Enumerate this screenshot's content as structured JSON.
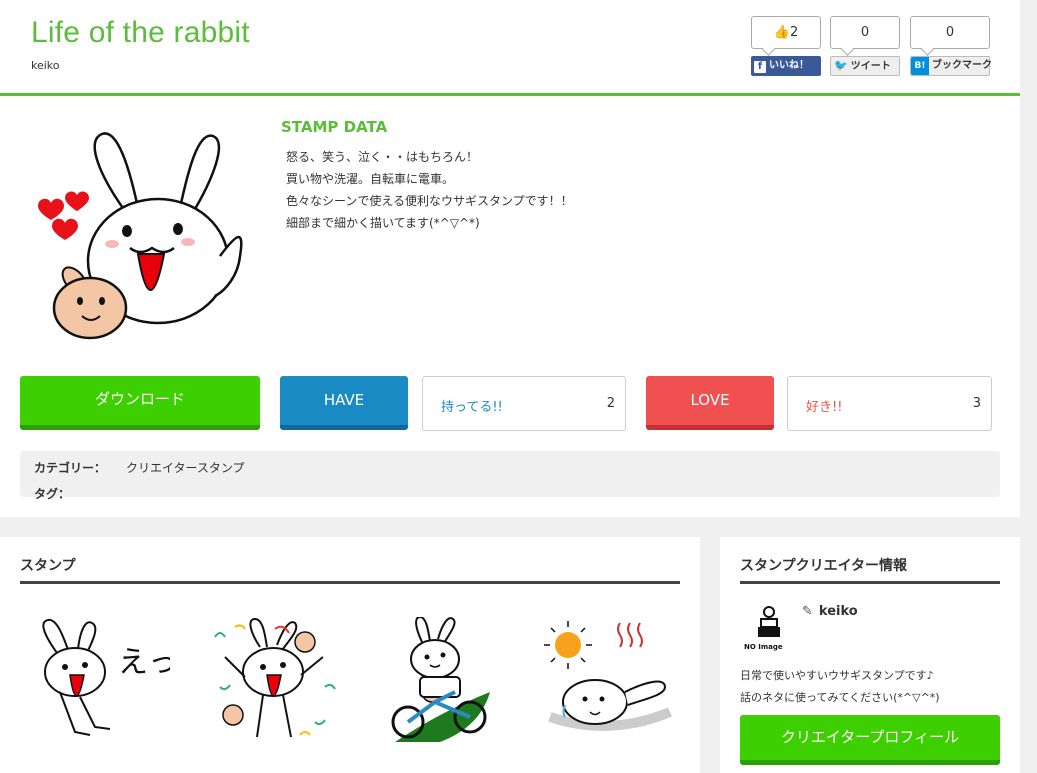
{
  "header": {
    "site_title": "Life of the rabbit",
    "author": "keiko",
    "share": {
      "facebook": {
        "count": "2",
        "label": "いいね！",
        "icon": "facebook-icon"
      },
      "twitter": {
        "count": "0",
        "label": "ツイート",
        "icon": "twitter-bird-icon"
      },
      "hatena": {
        "count": "0",
        "label": "ブックマーク",
        "icon": "hatena-bookmark-icon"
      }
    }
  },
  "stamp": {
    "section_title": "STAMP DATA",
    "description": [
      "怒る、笑う、泣く・・はもちろん！",
      "買い物や洗濯。自転車に電車。",
      "色々なシーンで使える便利なウサギスタンプです！！",
      "細部まで細かく描いてます(*^▽^*)"
    ],
    "download_label": "ダウンロード",
    "have_label": "HAVE",
    "have_text": "持ってる!!",
    "have_count": "2",
    "love_label": "LOVE",
    "love_text": "好き!!",
    "love_count": "3",
    "category_key": "カテゴリー：",
    "category_value": "クリエイタースタンプ",
    "tag_key": "タグ："
  },
  "stamps_panel": {
    "title": "スタンプ",
    "thumbs": [
      "rabbit-surprised-stamp",
      "rabbit-celebrating-stamp",
      "rabbit-bicycle-stamp",
      "rabbit-hot-sun-stamp"
    ],
    "surprise_text": "えっ"
  },
  "creator": {
    "title": "スタンプクリエイター情報",
    "noimage_text": "NO Image",
    "name": "keiko",
    "pen_icon": "pen-icon",
    "desc_lines": [
      "日常で使いやすいウサギスタンプです♪",
      "話のネタに使ってみてください(*^▽^*)"
    ],
    "profile_button": "クリエイタープロフィール"
  },
  "colors": {
    "brand_green": "#5bbd3b",
    "download_green": "#3ecf00",
    "have_blue": "#1a8ac4",
    "love_red": "#f05050"
  }
}
